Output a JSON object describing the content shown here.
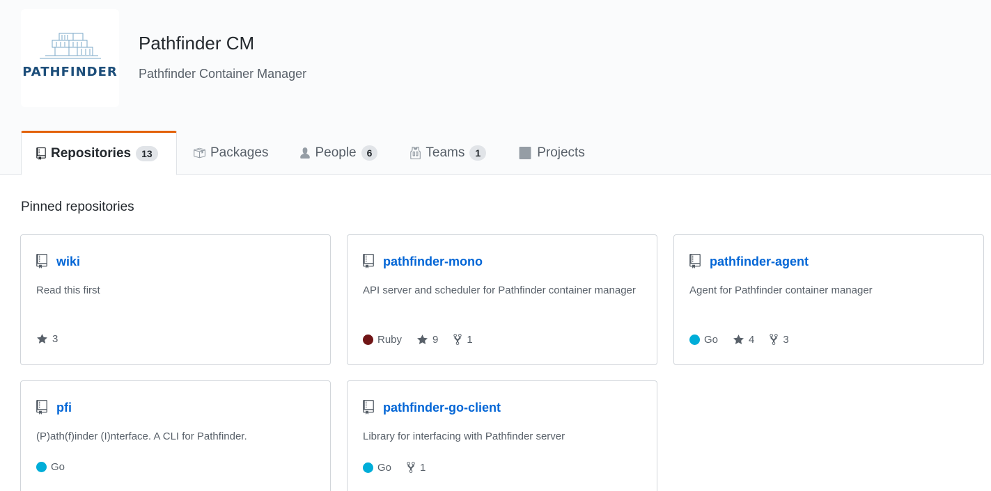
{
  "org": {
    "name": "Pathfinder CM",
    "description": "Pathfinder Container Manager",
    "logo_text": "PATHFINDER"
  },
  "tabs": [
    {
      "label": "Repositories",
      "count": "13",
      "icon": "repo-icon",
      "selected": true
    },
    {
      "label": "Packages",
      "icon": "package-icon"
    },
    {
      "label": "People",
      "count": "6",
      "icon": "person-icon"
    },
    {
      "label": "Teams",
      "count": "1",
      "icon": "jersey-icon"
    },
    {
      "label": "Projects",
      "icon": "project-icon"
    }
  ],
  "pinned": {
    "title": "Pinned repositories",
    "repos": [
      {
        "name": "wiki",
        "description": "Read this first",
        "stars": "3"
      },
      {
        "name": "pathfinder-mono",
        "description": "API server and scheduler for Pathfinder container manager",
        "language": "Ruby",
        "language_color": "#701516",
        "stars": "9",
        "forks": "1"
      },
      {
        "name": "pathfinder-agent",
        "description": "Agent for Pathfinder container manager",
        "language": "Go",
        "language_color": "#00ADD8",
        "stars": "4",
        "forks": "3"
      },
      {
        "name": "pfi",
        "description": "(P)ath(f)inder (I)nterface. A CLI for Pathfinder.",
        "language": "Go",
        "language_color": "#00ADD8"
      },
      {
        "name": "pathfinder-go-client",
        "description": "Library for interfacing with Pathfinder server",
        "language": "Go",
        "language_color": "#00ADD8",
        "forks": "1"
      }
    ]
  },
  "colors": {
    "link": "#0366d6",
    "selected_tab_accent": "#e36209",
    "header_bg": "#fafbfc"
  }
}
